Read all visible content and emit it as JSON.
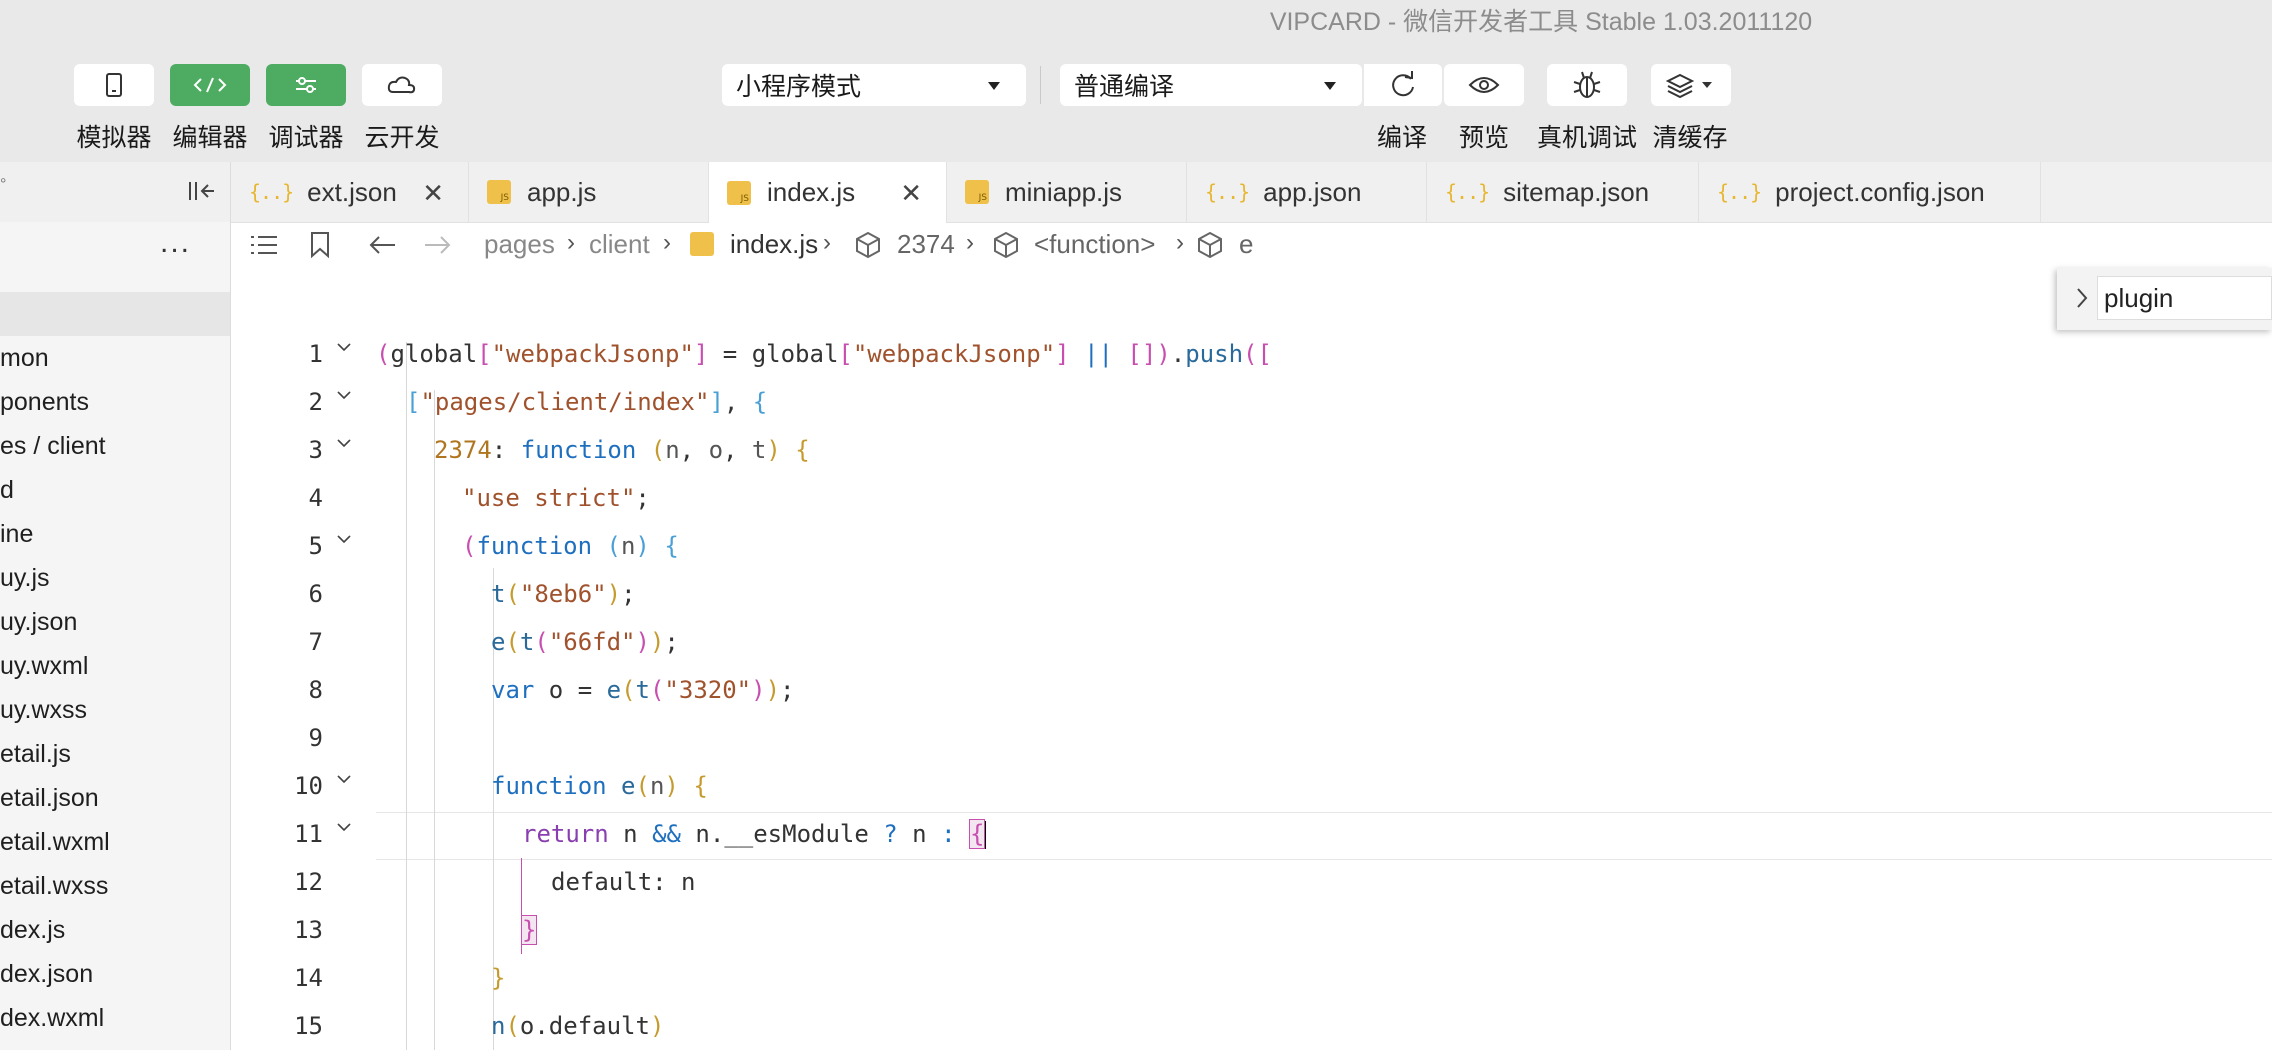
{
  "window": {
    "title": "VIPCARD - 微信开发者工具 Stable 1.03.2011120"
  },
  "toolbar": {
    "left_buttons": [
      {
        "label": "模拟器",
        "icon": "phone-icon"
      },
      {
        "label": "编辑器",
        "icon": "code-icon"
      },
      {
        "label": "调试器",
        "icon": "debug-sliders-icon"
      },
      {
        "label": "云开发",
        "icon": "cloud-icon"
      }
    ],
    "mode_select": "小程序模式",
    "compile_select": "普通编译",
    "right_buttons": [
      {
        "label": "编译",
        "icon": "refresh-icon"
      },
      {
        "label": "预览",
        "icon": "eye-icon"
      },
      {
        "label": "真机调试",
        "icon": "bug-icon"
      },
      {
        "label": "清缓存",
        "icon": "layers-icon"
      }
    ]
  },
  "tabs": [
    {
      "label": "ext.json",
      "type": "json"
    },
    {
      "label": "app.js",
      "type": "js"
    },
    {
      "label": "index.js",
      "type": "js",
      "active": true
    },
    {
      "label": "miniapp.js",
      "type": "js"
    },
    {
      "label": "app.json",
      "type": "json"
    },
    {
      "label": "sitemap.json",
      "type": "json"
    },
    {
      "label": "project.config.json",
      "type": "json"
    }
  ],
  "sidebar": {
    "more": "...",
    "items": [
      "mon",
      "ponents",
      "es / client",
      "d",
      "ine",
      "uy.js",
      "uy.json",
      "uy.wxml",
      "uy.wxss",
      "etail.js",
      "etail.json",
      "etail.wxml",
      "etail.wxss",
      "dex.js",
      "dex.json",
      "dex.wxml"
    ]
  },
  "breadcrumb": {
    "items": [
      "pages",
      "client",
      "index.js",
      "2374",
      "<function>",
      "e"
    ]
  },
  "find": {
    "value": "plugin"
  },
  "editor": {
    "line_numbers": [
      "1",
      "2",
      "3",
      "4",
      "5",
      "6",
      "7",
      "8",
      "9",
      "10",
      "11",
      "12",
      "13",
      "14",
      "15"
    ]
  }
}
